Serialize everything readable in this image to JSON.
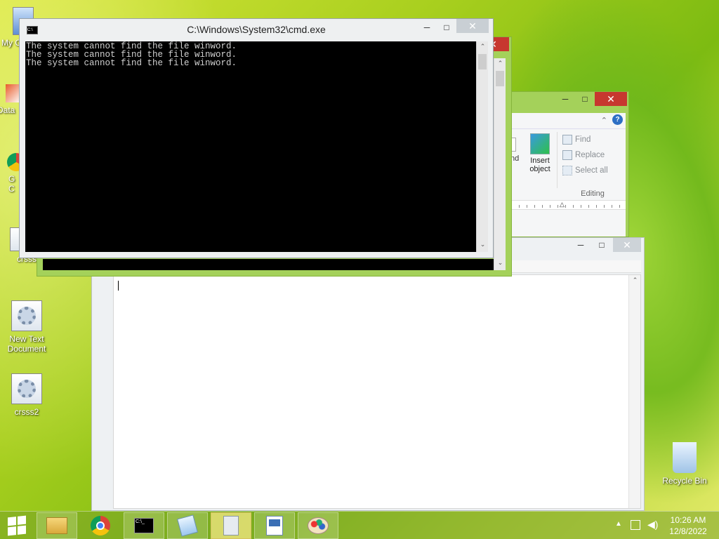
{
  "desktop": {
    "icons": [
      {
        "label": "My C",
        "icon": "computer-icon"
      },
      {
        "label": "Data",
        "icon": "shortcut-icon"
      },
      {
        "label": "G\nC",
        "icon": "chrome-icon"
      },
      {
        "label": "crsss",
        "icon": "gear-doc-icon"
      },
      {
        "label": "New Text\nDocument",
        "icon": "gear-doc-icon"
      },
      {
        "label": "crsss2",
        "icon": "gear-doc-icon"
      },
      {
        "label": "Recycle Bin",
        "icon": "recycle-bin-icon"
      }
    ]
  },
  "cmd": {
    "title": "C:\\Windows\\System32\\cmd.exe",
    "lines": [
      "The system cannot find the file winword.",
      "The system cannot find the file winword.",
      "The system cannot find the file winword."
    ],
    "min_label": "─",
    "max_label": "□",
    "close_label": "✕"
  },
  "wordpad": {
    "ribbon": {
      "partial_label": "nd",
      "insert_object": "Insert\nobject",
      "find": "Find",
      "replace": "Replace",
      "select_all": "Select all",
      "editing_group": "Editing"
    }
  },
  "taskbar": {
    "time": "10:26 AM",
    "date": "12/8/2022",
    "apps": [
      {
        "name": "file-explorer",
        "state": "pinned"
      },
      {
        "name": "chrome",
        "state": "pinned"
      },
      {
        "name": "cmd",
        "state": "open"
      },
      {
        "name": "notepad",
        "state": "open"
      },
      {
        "name": "calculator",
        "state": "active"
      },
      {
        "name": "wordpad",
        "state": "open"
      },
      {
        "name": "paint",
        "state": "open"
      }
    ]
  }
}
